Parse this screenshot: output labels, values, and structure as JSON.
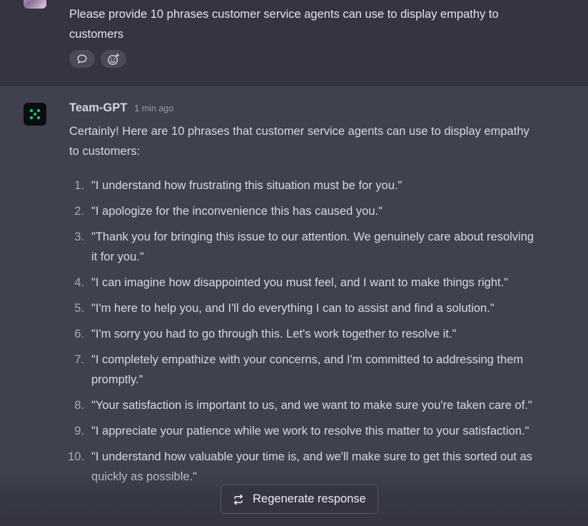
{
  "user_message": {
    "text": "Please provide 10 phrases customer service agents can use to display empathy to customers",
    "reactions": [
      "comment-icon",
      "add-reaction-icon"
    ]
  },
  "assistant_message": {
    "name": "Team-GPT",
    "time": "1 min ago",
    "intro": "Certainly! Here are 10 phrases that customer service agents can use to display empathy to customers:",
    "phrases": [
      {
        "num": "1.",
        "text": "\"I understand how frustrating this situation must be for you.\""
      },
      {
        "num": "2.",
        "text": "\"I apologize for the inconvenience this has caused you.\""
      },
      {
        "num": "3.",
        "text": "\"Thank you for bringing this issue to our attention. We genuinely care about resolving it for you.\""
      },
      {
        "num": "4.",
        "text": "\"I can imagine how disappointed you must feel, and I want to make things right.\""
      },
      {
        "num": "5.",
        "text": "\"I'm here to help you, and I'll do everything I can to assist and find a solution.\""
      },
      {
        "num": "6.",
        "text": "\"I'm sorry you had to go through this. Let's work together to resolve it.\""
      },
      {
        "num": "7.",
        "text": "\"I completely empathize with your concerns, and I'm committed to addressing them promptly.\""
      },
      {
        "num": "8.",
        "text": "\"Your satisfaction is important to us, and we want to make sure you're taken care of.\""
      },
      {
        "num": "9.",
        "text": "\"I appreciate your patience while we work to resolve this matter to your satisfaction.\""
      },
      {
        "num": "10.",
        "text": "\"I understand how valuable your time is, and we'll make sure to get this sorted out as quickly as possible.\""
      }
    ]
  },
  "regenerate": {
    "label": "Regenerate response",
    "icon": "regenerate-icon"
  },
  "colors": {
    "accent": "#19c37d",
    "background": "#40414f",
    "user_background": "#343541"
  }
}
